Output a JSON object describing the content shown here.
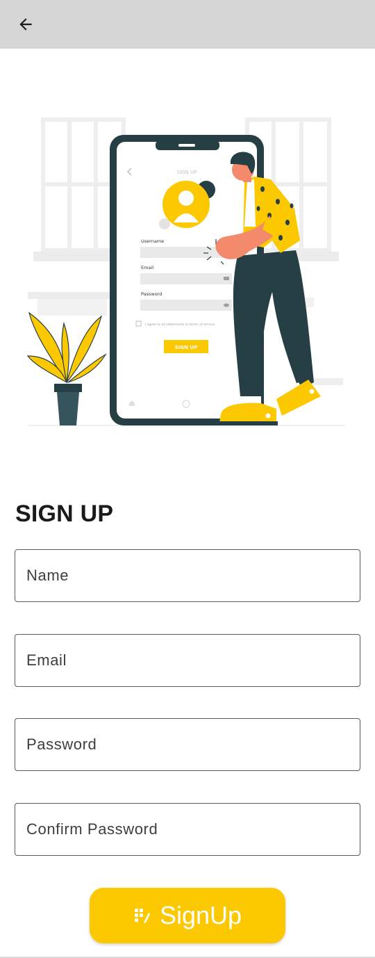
{
  "app_bar": {
    "back_icon": "arrow-back-icon"
  },
  "illustration": {
    "phone_title": "SIGN UP",
    "username_label": "Username",
    "email_label": "Email",
    "password_label": "Password",
    "agree_text": "I agree to all statements in terms of service",
    "phone_button": "SIGN UP"
  },
  "form": {
    "title": "SIGN UP",
    "name_placeholder": "Name",
    "email_placeholder": "Email",
    "password_placeholder": "Password",
    "confirm_placeholder": "Confirm Password"
  },
  "signup_button": {
    "label": "SignUp",
    "icon": "signup-grid-icon"
  },
  "colors": {
    "accent": "#fcc800",
    "dark": "#263f45",
    "appbar": "#d6d6d6"
  }
}
